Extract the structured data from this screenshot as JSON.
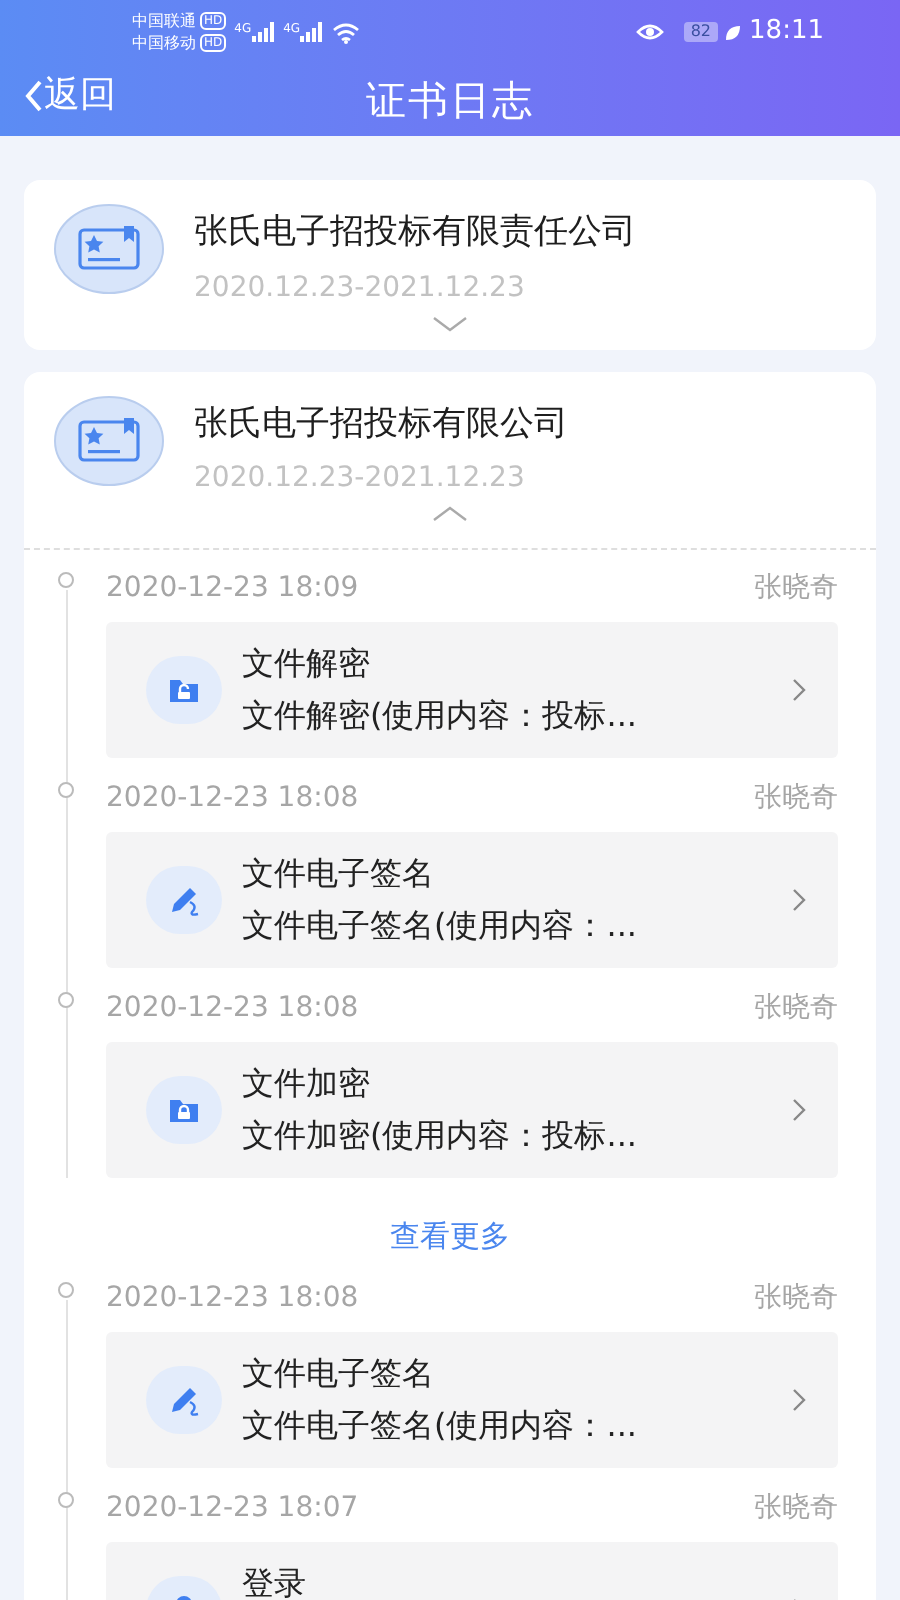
{
  "status_bar": {
    "carriers": [
      {
        "name": "中国联通",
        "badge": "HD"
      },
      {
        "name": "中国移动",
        "badge": "HD"
      }
    ],
    "network": [
      "4G",
      "4G"
    ],
    "battery": "82",
    "time": "18:11"
  },
  "header": {
    "back": "返回",
    "title": "证书日志"
  },
  "certificates": [
    {
      "name": "张氏电子招投标有限责任公司",
      "validity": "2020.12.23-2021.12.23",
      "expanded": false
    },
    {
      "name": "张氏电子招投标有限公司",
      "validity": "2020.12.23-2021.12.23",
      "expanded": true,
      "logs": [
        {
          "time": "2020-12-23 18:09",
          "user": "张晓奇",
          "kind": "decrypt",
          "title": "文件解密",
          "detail": "文件解密(使用内容：投标..."
        },
        {
          "time": "2020-12-23 18:08",
          "user": "张晓奇",
          "kind": "sign",
          "title": "文件电子签名",
          "detail": "文件电子签名(使用内容：..."
        },
        {
          "time": "2020-12-23 18:08",
          "user": "张晓奇",
          "kind": "encrypt",
          "title": "文件加密",
          "detail": "文件加密(使用内容：投标..."
        }
      ],
      "view_more": "查看更多",
      "more_logs": [
        {
          "time": "2020-12-23 18:08",
          "user": "张晓奇",
          "kind": "sign",
          "title": "文件电子签名",
          "detail": "文件电子签名(使用内容：..."
        },
        {
          "time": "2020-12-23 18:07",
          "user": "张晓奇",
          "kind": "login",
          "title": "登录"
        }
      ]
    }
  ]
}
